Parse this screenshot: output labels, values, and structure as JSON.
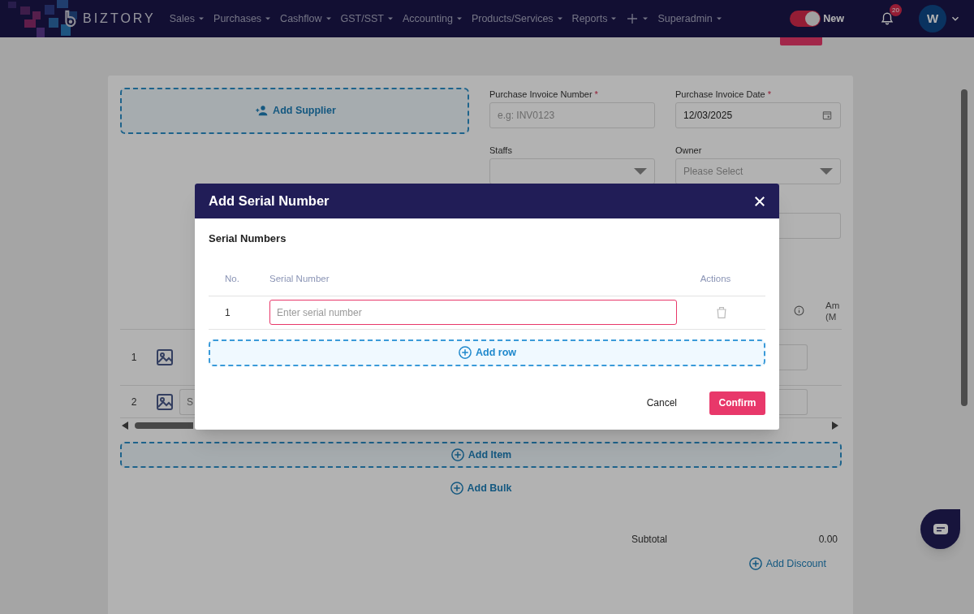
{
  "navbar": {
    "brand": "BIZTORY",
    "menu": [
      {
        "kind": "text",
        "label": "Sales",
        "dropdown": true
      },
      {
        "kind": "text",
        "label": "Purchases",
        "dropdown": true
      },
      {
        "kind": "text",
        "label": "Cashflow",
        "dropdown": true
      },
      {
        "kind": "text",
        "label": "GST/SST",
        "dropdown": true
      },
      {
        "kind": "text",
        "label": "Accounting",
        "dropdown": true
      },
      {
        "kind": "text",
        "label": "Products/Services",
        "dropdown": true
      },
      {
        "kind": "text",
        "label": "Reports",
        "dropdown": true
      },
      {
        "kind": "add",
        "dropdown": true
      },
      {
        "kind": "text",
        "label": "Superadmin",
        "dropdown": true
      }
    ],
    "new_toggle": {
      "label": "New",
      "on": true
    },
    "notifications": {
      "count": "20"
    },
    "avatar": {
      "initial": "W"
    }
  },
  "form": {
    "add_supplier": "Add Supplier",
    "fields": [
      {
        "kind": "input",
        "label": "Purchase Invoice Number",
        "required_mark": "*",
        "placeholder": "e.g: INV0123"
      },
      {
        "kind": "date",
        "label": "Purchase Invoice Date",
        "required_mark": "*",
        "value": "12/03/2025"
      },
      {
        "kind": "select",
        "label": "Staffs"
      },
      {
        "kind": "select",
        "label": "Owner",
        "placeholder": "Please Select"
      }
    ],
    "items_table": {
      "column_last": [
        "Am",
        "(M"
      ],
      "rows": [
        {
          "no": "1"
        },
        {
          "no": "2",
          "placeholder": "S"
        }
      ]
    },
    "add_item": "Add Item",
    "add_bulk": "Add Bulk",
    "subtotal": {
      "label": "Subtotal",
      "value": "0.00"
    },
    "add_discount": "Add Discount"
  },
  "dialog": {
    "title": "Add Serial Number",
    "section": "Serial Numbers",
    "columns": [
      "No.",
      "Serial Number",
      "Actions"
    ],
    "rows": [
      {
        "no": "1",
        "placeholder": "Enter serial number",
        "focused": true
      }
    ],
    "add_row": "Add row",
    "buttons": {
      "cancel": "Cancel",
      "confirm": "Confirm"
    }
  }
}
